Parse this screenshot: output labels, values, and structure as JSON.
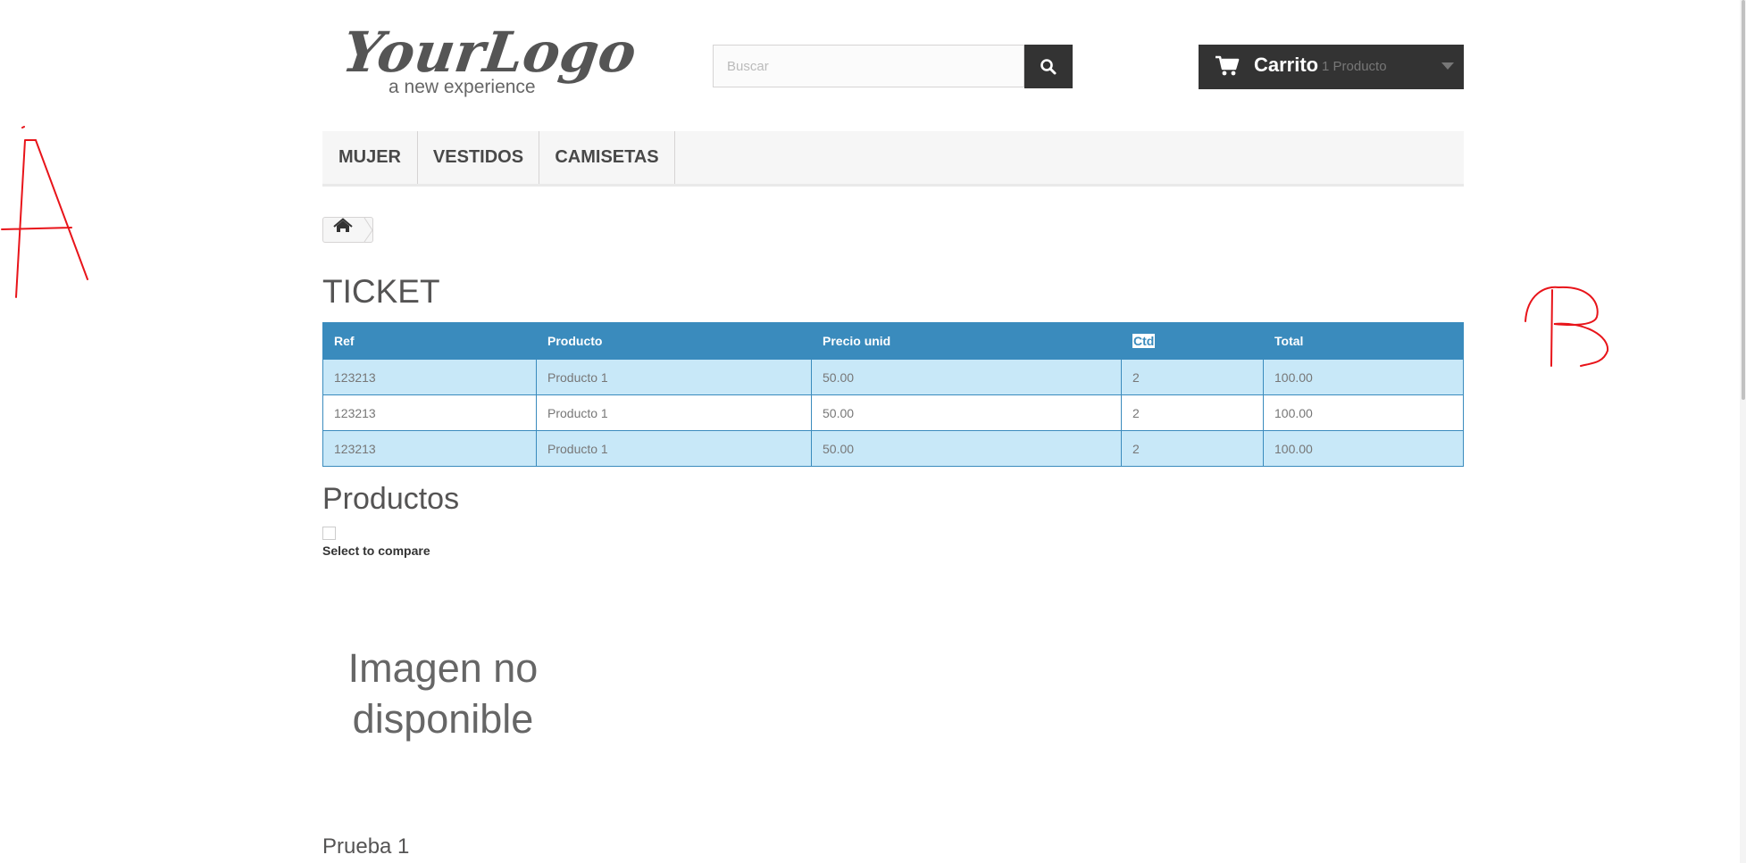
{
  "header": {
    "logo_text": "YourLogo",
    "logo_tagline": "a new experience",
    "search_placeholder": "Buscar",
    "cart_label": "Carrito",
    "cart_count": "1 Producto"
  },
  "menu": {
    "items": [
      {
        "label": "MUJER"
      },
      {
        "label": "VESTIDOS"
      },
      {
        "label": "CAMISETAS"
      }
    ]
  },
  "breadcrumb": {
    "home_icon": "home-icon"
  },
  "ticket": {
    "title": "TICKET",
    "columns": [
      "Ref",
      "Producto",
      "Precio unid",
      "Ctd",
      "Total"
    ],
    "rows": [
      [
        "123213",
        "Producto 1",
        "50.00",
        "2",
        "100.00"
      ],
      [
        "123213",
        "Producto 1",
        "50.00",
        "2",
        "100.00"
      ],
      [
        "123213",
        "Producto 1",
        "50.00",
        "2",
        "100.00"
      ]
    ]
  },
  "products": {
    "title": "Productos",
    "compare_label": "Select to compare",
    "no_image_text": [
      "Imagen no",
      "disponible"
    ],
    "product_name": "Prueba 1"
  },
  "annotations": {
    "left_mark": "A",
    "right_mark": "B"
  },
  "colors": {
    "table_header": "#3a8bbd",
    "table_row_alt": "#c8e8f8",
    "dark": "#333333",
    "scribble": "#e8141a"
  }
}
